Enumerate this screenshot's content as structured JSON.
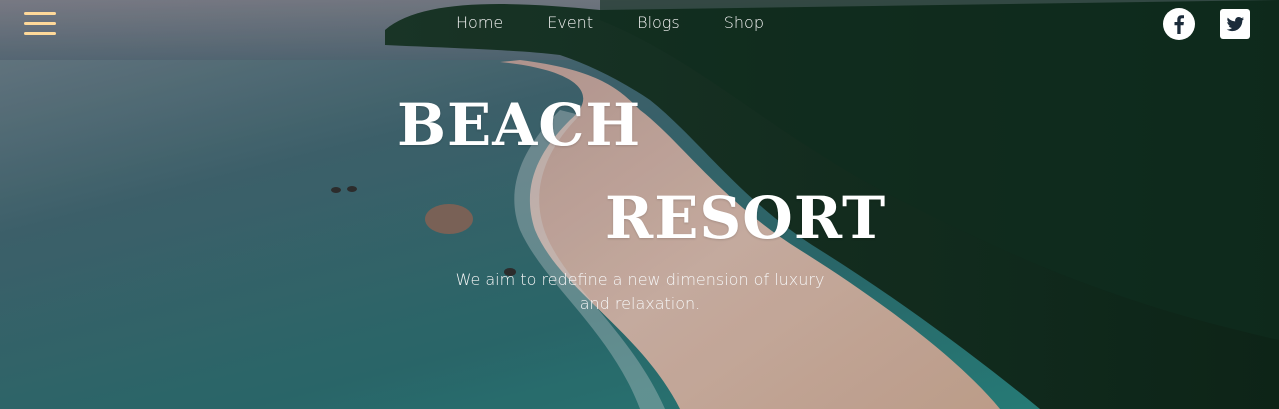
{
  "header": {
    "menu_icon": "hamburger-menu-icon",
    "nav_items": [
      {
        "label": "Home"
      },
      {
        "label": "Event"
      },
      {
        "label": "Blogs"
      },
      {
        "label": "Shop"
      }
    ],
    "social": [
      {
        "name": "facebook",
        "icon": "facebook-icon"
      },
      {
        "name": "twitter",
        "icon": "twitter-icon"
      }
    ]
  },
  "hero": {
    "title_line1": "BEACH",
    "title_line2": "RESORT",
    "subtitle": "We aim to redefine a new dimension of luxury and relaxation."
  },
  "colors": {
    "menu_icon": "#ffd99a",
    "text": "#ffffff",
    "sea": "#2f6f73",
    "sand": "#e7c9b7",
    "forest": "#173a24"
  }
}
